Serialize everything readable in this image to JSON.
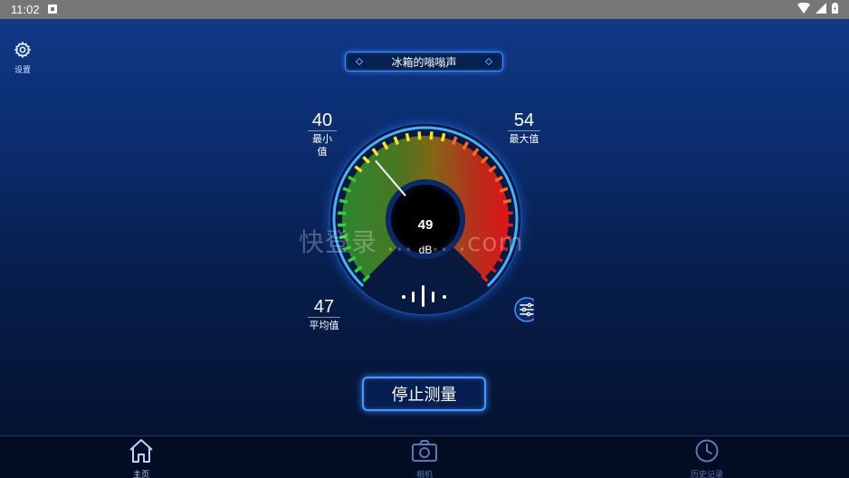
{
  "status_bar": {
    "time": "11:02"
  },
  "settings": {
    "label": "设置",
    "icon": "gear-icon"
  },
  "title": "冰箱的嗡嗡声",
  "stats": {
    "min": {
      "value": "40",
      "label": "最小值"
    },
    "max": {
      "value": "54",
      "label": "最大值"
    },
    "avg": {
      "value": "47",
      "label": "平均值"
    }
  },
  "gauge": {
    "current_value": "49",
    "unit": "dB",
    "needle_level": 0.35,
    "arc_colors": [
      "#2fd23c",
      "#f2e02a",
      "#ff6a1a",
      "#e51b1b"
    ]
  },
  "stop_button": {
    "label": "停止测量"
  },
  "watermark": "快登录 ... ... .com",
  "bottom_nav": [
    {
      "label": "主页",
      "icon": "home-icon",
      "active": true
    },
    {
      "label": "相机",
      "icon": "camera-icon",
      "active": false
    },
    {
      "label": "历史记录",
      "icon": "clock-icon",
      "active": false
    }
  ],
  "colors": {
    "accent": "#4a98ff",
    "background_top": "#103a8a",
    "background_bottom": "#03102a"
  }
}
